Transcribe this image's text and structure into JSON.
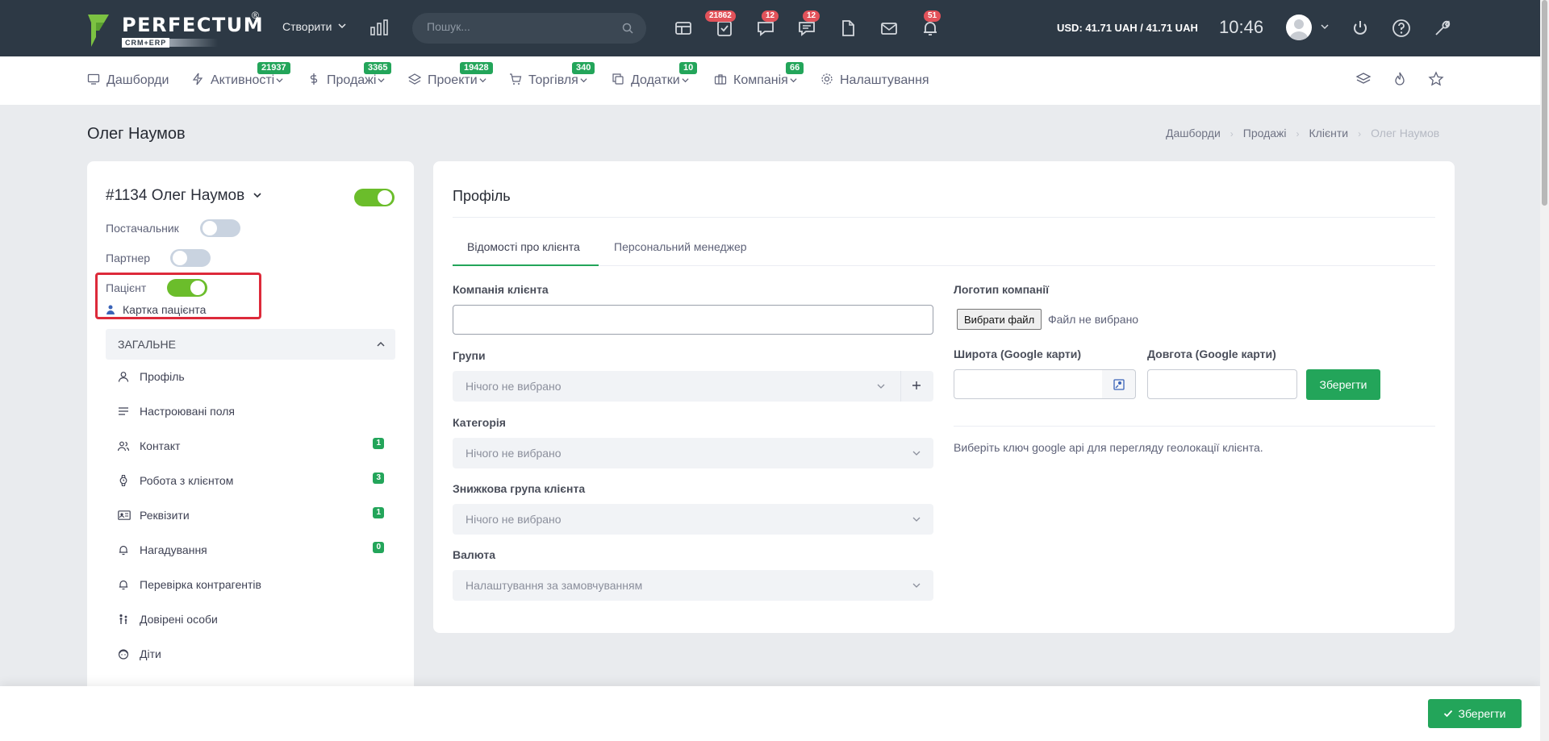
{
  "header": {
    "logo_text": "PERFECTUM",
    "logo_reg": "®",
    "logo_sub": "CRM+ERP",
    "create_label": "Створити",
    "search_placeholder": "Пошук...",
    "badges": {
      "tasks": "21862",
      "chat": "12",
      "messages": "12",
      "notifications": "51"
    },
    "currency": "USD: 41.71 UAH / 41.71 UAH",
    "time": "10:46"
  },
  "nav": {
    "items": [
      {
        "label": "Дашборди",
        "icon": "monitor-icon"
      },
      {
        "label": "Активності",
        "badge": "21937",
        "icon": "bolt-icon"
      },
      {
        "label": "Продажі",
        "badge": "3365",
        "icon": "dollar-icon"
      },
      {
        "label": "Проекти",
        "badge": "19428",
        "icon": "layers-icon"
      },
      {
        "label": "Торгівля",
        "badge": "340",
        "icon": "cart-icon"
      },
      {
        "label": "Додатки",
        "badge": "10",
        "icon": "copy-icon"
      },
      {
        "label": "Компанія",
        "badge": "66",
        "icon": "briefcase-icon"
      },
      {
        "label": "Налаштування",
        "icon": "gear-icon"
      }
    ]
  },
  "page": {
    "title": "Олег Наумов",
    "breadcrumb": [
      "Дашборди",
      "Продажі",
      "Клієнти",
      "Олег Наумов"
    ]
  },
  "left": {
    "client_title": "#1134 Олег Наумов",
    "supplier_label": "Постачальник",
    "partner_label": "Партнер",
    "patient_label": "Пацієнт",
    "patient_card": "Картка пацієнта",
    "section": "ЗАГАЛЬНЕ",
    "menu": [
      {
        "label": "Профіль",
        "icon": "user-icon"
      },
      {
        "label": "Настроювані поля",
        "icon": "lines-icon"
      },
      {
        "label": "Контакт",
        "badge": "1",
        "icon": "users-icon"
      },
      {
        "label": "Робота з клієнтом",
        "badge": "3",
        "icon": "watch-icon"
      },
      {
        "label": "Реквізити",
        "badge": "1",
        "icon": "id-card-icon"
      },
      {
        "label": "Нагадування",
        "badge": "0",
        "icon": "bell-icon"
      },
      {
        "label": "Перевірка контрагентів",
        "icon": "bell-icon"
      },
      {
        "label": "Довірені особи",
        "icon": "people-icon"
      },
      {
        "label": "Діти",
        "icon": "child-icon"
      }
    ]
  },
  "profile": {
    "title": "Профіль",
    "tabs": [
      "Відомості про клієнта",
      "Персональний менеджер"
    ],
    "company_label": "Компанія клієнта",
    "company_value": "",
    "groups_label": "Групи",
    "groups_value": "Нічого не вибрано",
    "category_label": "Категорія",
    "category_value": "Нічого не вибрано",
    "discount_label": "Знижкова група клієнта",
    "discount_value": "Нічого не вибрано",
    "currency_label": "Валюта",
    "currency_value": "Налаштування за замовчуванням",
    "logo_label": "Логотип компанії",
    "file_button": "Вибрати файл",
    "file_none": "Файл не вибрано",
    "lat_label": "Широта (Google карти)",
    "lng_label": "Довгота (Google карти)",
    "save_label": "Зберегти",
    "geo_note": "Виберіть ключ google api для перегляду геолокації клієнта."
  },
  "footer": {
    "save_label": "Зберегти"
  },
  "colors": {
    "topbar": "#2d3945",
    "accent_green": "#23a55a",
    "toggle_on": "#6bbd2b",
    "badge_red": "#e2525a",
    "highlight": "#dd2a3a"
  }
}
